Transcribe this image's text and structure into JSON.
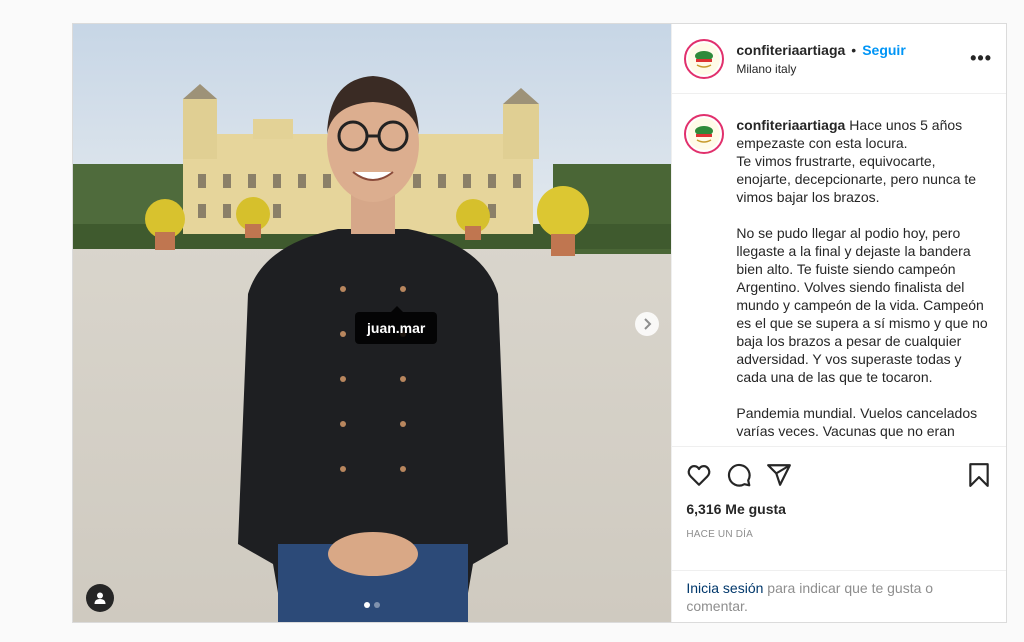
{
  "post": {
    "username": "confiteriaartiaga",
    "follow_label": "Seguir",
    "separator": "•",
    "location": "Milano italy",
    "more_label": "•••",
    "photo_tag": "juan.mar",
    "caption_paragraphs": [
      "Hace unos 5 años empezaste con esta locura.\nTe vimos frustrarte, equivocarte, enojarte, decepcionarte, pero nunca te vimos bajar los brazos.",
      "No se pudo llegar al podio hoy, pero llegaste a la final y dejaste la bandera bien alto. Te fuiste siendo campeón Argentino. Volves siendo finalista del mundo y campeón de la vida. Campeón es el que se supera a sí mismo y que no baja los brazos a pesar de cualquier adversidad. Y vos superaste todas y cada una de las que te tocaron.",
      "Pandemia mundial. Vuelos cancelados varías veces. Vacunas que no eran"
    ],
    "likes": "6,316 Me gusta",
    "time": "HACE UN DÍA",
    "login_link": "Inicia sesión",
    "login_text": " para indicar que te gusta o comentar."
  },
  "icons": {
    "like": "heart-icon",
    "comment": "comment-icon",
    "share": "share-icon",
    "save": "bookmark-icon",
    "next": "chevron-right-icon",
    "user_tag": "person-icon"
  },
  "colors": {
    "follow": "#0095f6",
    "link": "#00376b",
    "muted": "#8e8e8e"
  },
  "carousel": {
    "slides": 2,
    "current": 1
  }
}
